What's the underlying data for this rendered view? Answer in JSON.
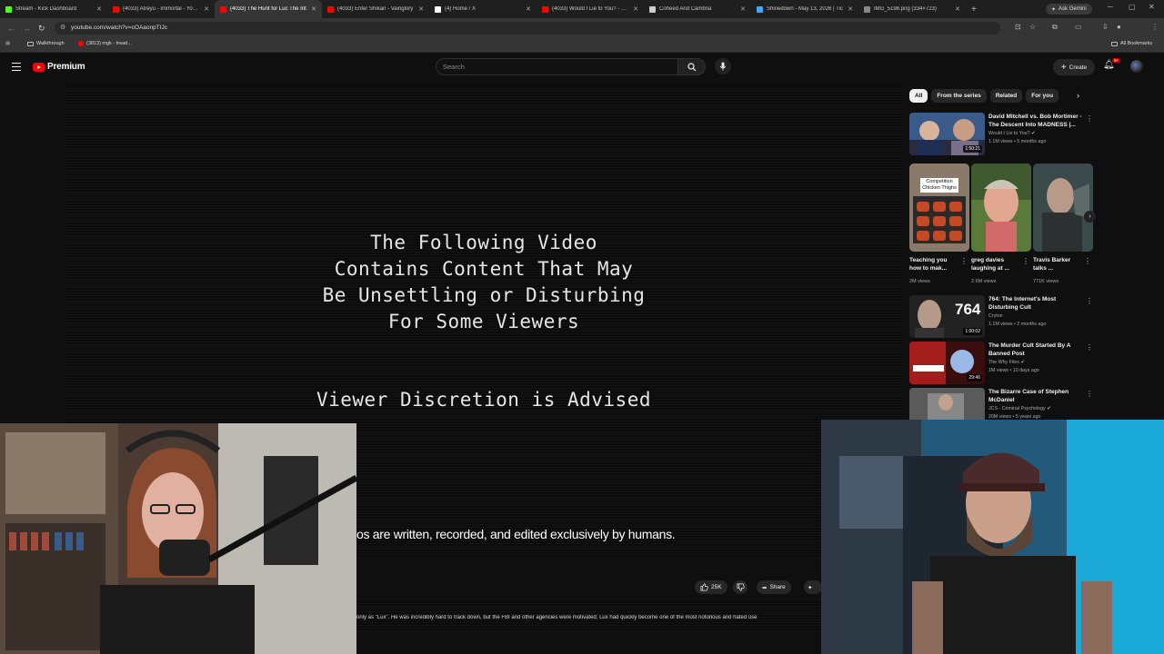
{
  "browser": {
    "tabs": [
      {
        "title": "Stream - Kick Dashboard",
        "favicon_color": "#53fc18"
      },
      {
        "title": "(4033) Atreyu - Immortal - YouTube",
        "favicon_color": "#ff0000"
      },
      {
        "title": "(4033) The Hunt for Luc The Int",
        "favicon_color": "#ff0000",
        "active": true
      },
      {
        "title": "(4033) Enter Shikari - Vainglory",
        "favicon_color": "#ff0000"
      },
      {
        "title": "(4) Home / X",
        "favicon_color": "#ffffff"
      },
      {
        "title": "(4033) Would I Lie to You? - Ser",
        "favicon_color": "#ff0000"
      },
      {
        "title": "Coheed And Cambria",
        "favicon_color": "#cccccc"
      },
      {
        "title": "Shinedown - May 13, 2026 | Tic",
        "favicon_color": "#3fa7ff"
      },
      {
        "title": "IMG_5198.png (334×723)",
        "favicon_color": "#888888"
      }
    ],
    "gemini_label": "Ask Gemini",
    "url": "youtube.com/watch?v=cOAaonpTIJc",
    "bookmarks": [
      {
        "label": "Walkthrough"
      },
      {
        "label": "(3813) mgk - tread..."
      }
    ],
    "all_bookmarks": "All Bookmarks"
  },
  "youtube": {
    "brand": "Premium",
    "search_placeholder": "Search",
    "create_label": "Create",
    "notif_count": "9+"
  },
  "video": {
    "warning_lines": [
      "The Following Video",
      "Contains Content That May",
      "Be Unsettling or Disturbing",
      "For Some Viewers"
    ],
    "advisory": "Viewer Discretion is Advised",
    "subtitle": "os are written, recorded, and edited exclusively by humans.",
    "like_count": "25K",
    "share_label": "Share",
    "description": "only as \"Lux\". He was incredibly hard to track down, but the FBI and other agencies were motivated; Lux had quickly become one of the most notorious and hated use"
  },
  "sidebar": {
    "chips": [
      "All",
      "From the series",
      "Related",
      "For you"
    ],
    "recs": [
      {
        "title": "David Mitchell vs. Bob Mortimer - The Descent Into MADNESS |...",
        "channel": "Would I Lie to You?",
        "meta": "1.1M views • 5 months ago",
        "duration": "1:50:21"
      },
      {
        "title": "764: The Internet's Most Disturbing Cult",
        "channel": "Cryton",
        "meta": "1.1M views • 2 months ago",
        "duration": "1:00:02"
      },
      {
        "title": "The Murder Cult Started By A Banned Post",
        "channel": "The Why Files",
        "meta": "1M views • 10 days ago",
        "duration": "29:46"
      },
      {
        "title": "The Bizarre Case of Stephen McDaniel",
        "channel": "JCS - Criminal Psychology",
        "meta": "20M views • 5 years ago",
        "duration": ""
      }
    ],
    "shorts": [
      {
        "title": "Teaching you how to mak...",
        "views": "2M views",
        "overlay": "Competition Chicken Thighs"
      },
      {
        "title": "greg davies laughing at ...",
        "views": "2.6M views",
        "overlay": ""
      },
      {
        "title": "Travis Barker talks ...",
        "views": "771K views",
        "overlay": ""
      }
    ],
    "thumb_764": "764"
  }
}
